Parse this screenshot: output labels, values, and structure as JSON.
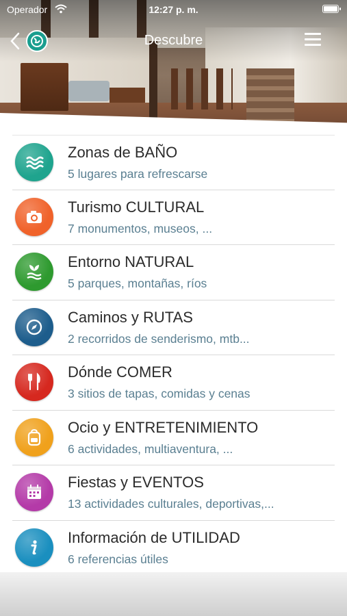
{
  "status_bar": {
    "carrier": "Operador",
    "time": "12:27 p. m."
  },
  "nav": {
    "title": "Descubre"
  },
  "colors": {
    "accent": "#1a9e8f",
    "subtitle": "#5a7f91"
  },
  "items": [
    {
      "title": "Zonas de BAÑO",
      "subtitle": "5 lugares para refrescarse",
      "icon": "waves-icon",
      "color": "#1fa48e"
    },
    {
      "title": "Turismo CULTURAL",
      "subtitle": "7 monumentos, museos, ...",
      "icon": "camera-icon",
      "color": "#f0622a"
    },
    {
      "title": "Entorno NATURAL",
      "subtitle": "5 parques, montañas, ríos",
      "icon": "leaf-icon",
      "color": "#2e9a2f"
    },
    {
      "title": "Caminos y RUTAS",
      "subtitle": "2 recorridos de senderismo, mtb...",
      "icon": "compass-icon",
      "color": "#1d5d8c"
    },
    {
      "title": "Dónde COMER",
      "subtitle": "3 sitios de tapas, comidas y cenas",
      "icon": "fork-knife-icon",
      "color": "#d6281f"
    },
    {
      "title": "Ocio y ENTRETENIMIENTO",
      "subtitle": "6 actividades, multiaventura, ...",
      "icon": "backpack-icon",
      "color": "#f0a11c"
    },
    {
      "title": "Fiestas y EVENTOS",
      "subtitle": "13 actividades culturales, deportivas,...",
      "icon": "calendar-icon",
      "color": "#b43aa8"
    },
    {
      "title": "Información de UTILIDAD",
      "subtitle": "6 referencias útiles",
      "icon": "info-icon",
      "color": "#1a8fbf"
    }
  ]
}
